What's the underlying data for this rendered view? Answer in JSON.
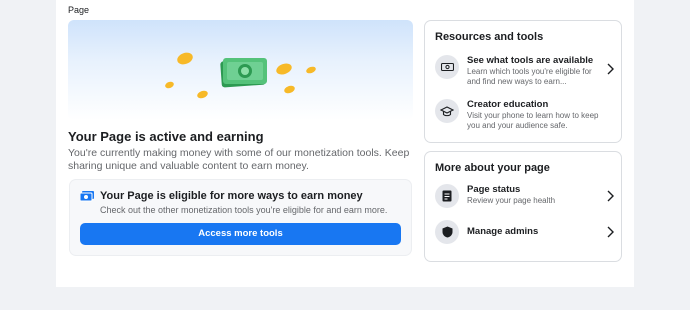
{
  "page": {
    "label": "Page"
  },
  "hero": {
    "illustration": "money-coins-illustration"
  },
  "earning": {
    "title": "Your Page is active and earning",
    "description": "You're currently making money with some of our monetization tools. Keep sharing unique and valuable content to earn money."
  },
  "eligible": {
    "icon": "cash-icon",
    "title": "Your Page is eligible for more ways to earn money",
    "subtitle": "Check out the other monetization tools you're eligible for and earn more.",
    "button_label": "Access more tools"
  },
  "resources": {
    "title": "Resources and tools",
    "items": [
      {
        "icon": "money-tools-icon",
        "title": "See what tools are available",
        "subtitle": "Learn which tools you're eligible for and find new ways to earn...",
        "has_chevron": true
      },
      {
        "icon": "graduation-cap-icon",
        "title": "Creator education",
        "subtitle": "Visit your phone to learn how to keep you and your audience safe.",
        "has_chevron": false
      }
    ]
  },
  "more_about": {
    "title": "More about your page",
    "items": [
      {
        "icon": "page-status-icon",
        "title": "Page status",
        "subtitle": "Review your page health",
        "has_chevron": true
      },
      {
        "icon": "shield-icon",
        "title": "Manage admins",
        "subtitle": "",
        "has_chevron": true
      }
    ]
  },
  "colors": {
    "primary": "#1877f2",
    "coin": "#f7b928",
    "bill": "#3fb869",
    "text_secondary": "#65676b"
  }
}
